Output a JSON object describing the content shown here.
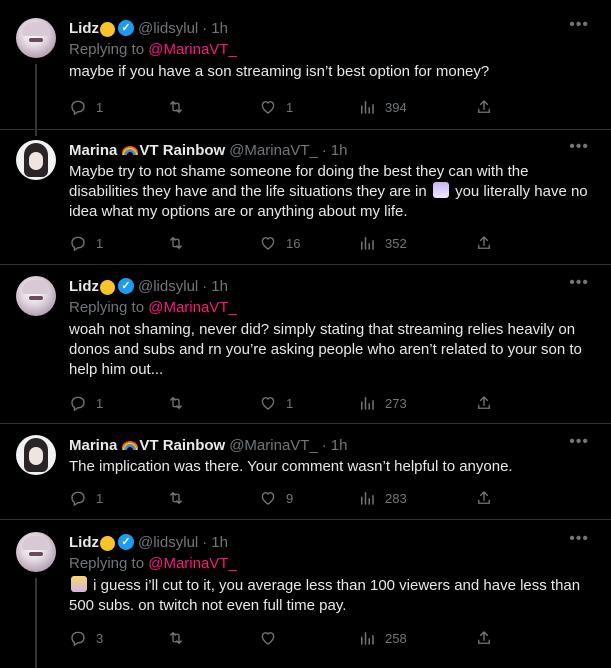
{
  "tweets": [
    {
      "name": "Lidz",
      "author_emoji": "🤭",
      "verified": true,
      "handle": "@lidsylul",
      "time": "1h",
      "replying_prefix": "Replying to",
      "replying_to": "@MarinaVT_",
      "text": "maybe if you have a son streaming isn’t best option for money?",
      "stats": {
        "replies": "1",
        "retweets": "",
        "likes": "1",
        "views": "394"
      }
    },
    {
      "name": "Marina",
      "name_suffix": "VT Rainbow",
      "handle": "@MarinaVT_",
      "time": "1h",
      "text_before": "Maybe try to not shame someone for doing the best they can with the disabilities they have and the life situations they are in",
      "text_after": "you literally have no idea what my options are or anything about my life.",
      "inline_emoji": "shrug-emoji",
      "stats": {
        "replies": "1",
        "retweets": "",
        "likes": "16",
        "views": "352"
      }
    },
    {
      "name": "Lidz",
      "author_emoji": "🤭",
      "verified": true,
      "handle": "@lidsylul",
      "time": "1h",
      "replying_prefix": "Replying to",
      "replying_to": "@MarinaVT_",
      "text": "woah not shaming, never did? simply stating that streaming relies heavily on donos and subs and rn you’re asking people who aren’t related to your son to help him out...",
      "stats": {
        "replies": "1",
        "retweets": "",
        "likes": "1",
        "views": "273"
      }
    },
    {
      "name": "Marina",
      "name_suffix": "VT Rainbow",
      "handle": "@MarinaVT_",
      "time": "1h",
      "text": "The implication was there. Your comment wasn’t helpful to anyone.",
      "stats": {
        "replies": "1",
        "retweets": "",
        "likes": "9",
        "views": "283"
      }
    },
    {
      "name": "Lidz",
      "author_emoji": "🤭",
      "verified": true,
      "handle": "@lidsylul",
      "time": "1h",
      "replying_prefix": "Replying to",
      "replying_to": "@MarinaVT_",
      "text": "i guess i’ll cut to it, you average less than 100 viewers and have less than 500 subs. on twitch not even full time pay.",
      "inline_emoji": "facepalm-emoji",
      "stats": {
        "replies": "3",
        "retweets": "",
        "likes": "",
        "views": "258"
      }
    }
  ],
  "colors": {
    "background": "#000000",
    "text": "#e7e9ea",
    "muted": "#71767b",
    "mention": "#f91880",
    "verified": "#1d9bf0",
    "divider": "#2f3336"
  }
}
